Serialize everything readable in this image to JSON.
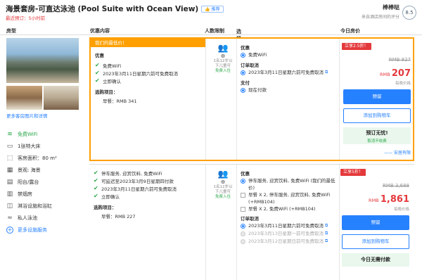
{
  "header": {
    "title": "海景套房-可直达泳池 (Pool Suite with Ocean View)",
    "like_label": "👍 推荐",
    "last_booked": "最近预订：5小时前",
    "review_label": "棒棒哒",
    "review_sub": "来自酒店房间的评分",
    "review_score": "8.5"
  },
  "columns": {
    "room": "房型",
    "offer": "优惠内容",
    "guests": "人数限制",
    "prefs": "选择偏好客房",
    "prefs_info": "ⓘ",
    "price": "今日房价"
  },
  "room": {
    "more_photos": "更多客房图片和详情",
    "amenities": [
      {
        "icon": "wifi-icon",
        "glyph": "≋",
        "label": "免费WiFi"
      },
      {
        "icon": "bed-icon",
        "glyph": "▭",
        "label": "1张特大床"
      },
      {
        "icon": "area-icon",
        "glyph": "⬚",
        "label": "客房面积：80 m²"
      },
      {
        "icon": "view-icon",
        "glyph": "▦",
        "label": "景观: 海景"
      },
      {
        "icon": "balcony-icon",
        "glyph": "▤",
        "label": "阳台/露台"
      },
      {
        "icon": "smoke-icon",
        "glyph": "▥",
        "label": "禁烟房"
      },
      {
        "icon": "bathtub-icon",
        "glyph": "◫",
        "label": "淋浴设施和浴缸"
      },
      {
        "icon": "pool-icon",
        "glyph": "≈",
        "label": "私人泳池"
      },
      {
        "icon": "plus-icon",
        "glyph": "+",
        "label": "更多设施服务"
      }
    ]
  },
  "offer1": {
    "banner": "我们的最低价！",
    "perks_title": "优惠",
    "perks": [
      "免费WiFi",
      "2023年3月11日星期六前可免费取消",
      "立即确认"
    ],
    "options_title": "选购项目：",
    "options": [
      "早餐：RMB 341"
    ],
    "guests_line1": "1名12岁以",
    "guests_line2": "下儿童可",
    "guests_line3": "免费入住",
    "pref_perks_title": "优惠",
    "pref_perks": [
      "免费WiFi"
    ],
    "pref_cancel_title": "订单取消",
    "pref_cancel": [
      "2023年3月11日星期六前可免费取消"
    ],
    "pref_pay_title": "支付",
    "pref_pay": [
      "现在付款"
    ],
    "tag": "立享2.5折！",
    "orig_price": "RMB 827",
    "price_currency": "RMB",
    "price_value": "207",
    "per_night": "每晚价格",
    "book_label": "预留",
    "cart_label": "添加到购物车",
    "nopay_title": "预订无忧!",
    "nopay_sub": "取消不收费",
    "safe_label": "—— 安居有限"
  },
  "offer2": {
    "perks": [
      "停车服务, 迎宾饮料, 免费WiFi",
      "可延迟至2023年3月9日星期四付款",
      "2023年3月11日星期六前可免费取消",
      "立即确认"
    ],
    "options_title": "选购项目：",
    "options": [
      "早餐：RMB 227"
    ],
    "guests_line1": "1名12岁以",
    "guests_line2": "下儿童可",
    "guests_line3": "免费入住",
    "pref_perks_title": "优惠",
    "pref_perks": [
      "停车服务, 迎宾饮料, 免费WiFi (我们的最低价)",
      "早餐 X 2, 停车服务, 迎宾饮料, 免费WiFi (+RMB104)",
      "早餐 X 2, 免费WiFi (+RMB104)"
    ],
    "pref_cancel_title": "订单取消",
    "pref_cancel": [
      "2023年3月11日星期六前可免费取消",
      "2023年3月13日星期一前可免费取消",
      "2023年3月12日星期日前可免费取消"
    ],
    "tag": "立享5折！",
    "orig_price": "RMB 3,688",
    "price_currency": "RMB",
    "price_value": "1,861",
    "per_night": "每晚价格",
    "book_label": "预留",
    "cart_label": "添加到购物车",
    "nopay_title": "今日无需付款"
  },
  "colors": {
    "accent": "#2681ff",
    "highlight": "#ffa000",
    "sale": "#e4393c",
    "green": "#2ba84a"
  }
}
